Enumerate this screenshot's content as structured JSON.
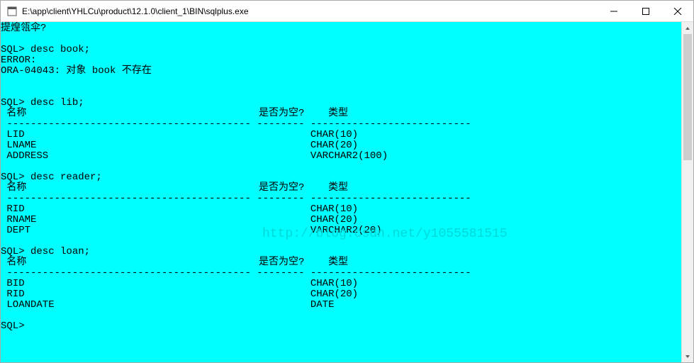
{
  "window": {
    "title": "E:\\app\\client\\YHLCu\\product\\12.1.0\\client_1\\BIN\\sqlplus.exe"
  },
  "watermark": "http://blog.csdn.net/y1055581515",
  "terminal": {
    "garbled_line": "提煌瓴伞?",
    "prompt": "SQL>",
    "cmd_desc_book": "desc book;",
    "error_label": "ERROR:",
    "error_msg": "ORA-04043: 对象 book 不存在",
    "cmd_desc_lib": "desc lib;",
    "hdr_name": "名称",
    "hdr_null": "是否为空?",
    "hdr_type": "类型",
    "lib_rows": [
      {
        "name": "LID",
        "type": "CHAR(10)"
      },
      {
        "name": "LNAME",
        "type": "CHAR(20)"
      },
      {
        "name": "ADDRESS",
        "type": "VARCHAR2(100)"
      }
    ],
    "cmd_desc_reader": "desc reader;",
    "reader_rows": [
      {
        "name": "RID",
        "type": "CHAR(10)"
      },
      {
        "name": "RNAME",
        "type": "CHAR(20)"
      },
      {
        "name": "DEPT",
        "type": "VARCHAR2(20)"
      }
    ],
    "cmd_desc_loan": "desc loan;",
    "loan_rows": [
      {
        "name": "BID",
        "type": "CHAR(10)"
      },
      {
        "name": "RID",
        "type": "CHAR(20)"
      },
      {
        "name": "LOANDATE",
        "type": "DATE"
      }
    ]
  }
}
